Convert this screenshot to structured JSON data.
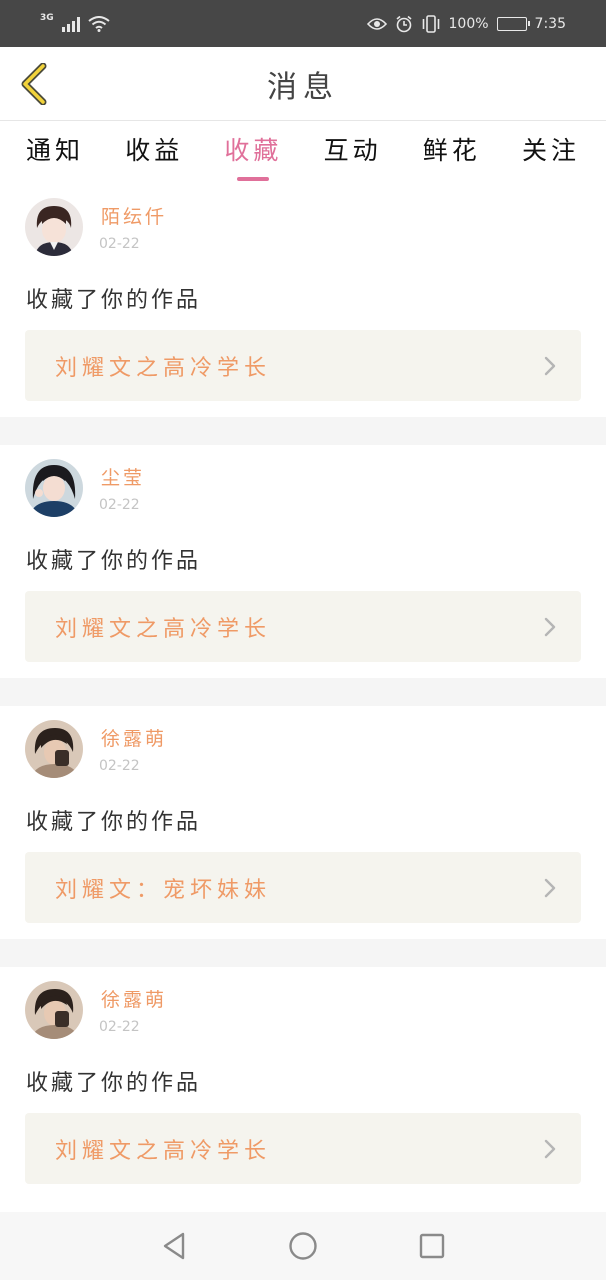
{
  "status_bar": {
    "network": "3G",
    "battery": "100%",
    "time": "7:35",
    "icons": [
      "signal-icon",
      "wifi-icon",
      "eye-icon",
      "alarm-icon",
      "vibrate-icon",
      "battery-icon"
    ]
  },
  "header": {
    "title": "消息",
    "back_icon": "chevron-left-icon",
    "accent": "#f2d33a"
  },
  "tabs": [
    {
      "label": "通知",
      "active": false
    },
    {
      "label": "收益",
      "active": false
    },
    {
      "label": "收藏",
      "active": true
    },
    {
      "label": "互动",
      "active": false
    },
    {
      "label": "鲜花",
      "active": false
    },
    {
      "label": "关注",
      "active": false
    }
  ],
  "colors": {
    "active_tab": "#e0709a",
    "name": "#ef9a66",
    "work_bg": "#f5f4ee"
  },
  "messages": [
    {
      "name": "陌纭仟",
      "date": "02-22",
      "action": "收藏了你的作品",
      "work": "刘耀文之高冷学长"
    },
    {
      "name": "尘莹",
      "date": "02-22",
      "action": "收藏了你的作品",
      "work": "刘耀文之高冷学长"
    },
    {
      "name": "徐露萌",
      "date": "02-22",
      "action": "收藏了你的作品",
      "work": "刘耀文：宠坏妹妹"
    },
    {
      "name": "徐露萌",
      "date": "02-22",
      "action": "收藏了你的作品",
      "work": "刘耀文之高冷学长"
    }
  ],
  "nav": [
    "back-triangle-icon",
    "home-circle-icon",
    "recents-square-icon"
  ]
}
